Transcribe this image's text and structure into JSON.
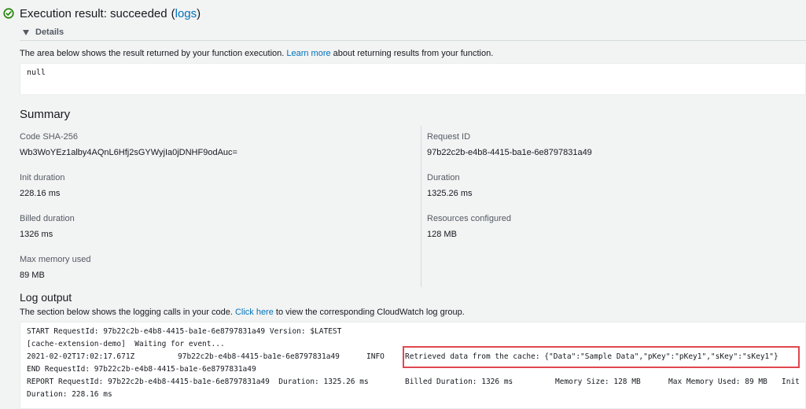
{
  "execution": {
    "status_prefix": "Execution result: succeeded",
    "open_paren": "(",
    "logs_link": "logs",
    "close_paren": ")"
  },
  "details": {
    "toggle_label": "Details",
    "desc_before": "The area below shows the result returned by your function execution. ",
    "desc_link": "Learn more",
    "desc_after": " about returning results from your function.",
    "result_value": "null"
  },
  "summary": {
    "heading": "Summary",
    "fields": [
      {
        "label": "Code SHA-256",
        "value": "Wb3WoYEz1alby4AQnL6Hfj2sGYWyjIa0jDNHF9odAuc="
      },
      {
        "label": "Request ID",
        "value": "97b22c2b-e4b8-4415-ba1e-6e8797831a49"
      },
      {
        "label": "Init duration",
        "value": "228.16 ms"
      },
      {
        "label": "Duration",
        "value": "1325.26 ms"
      },
      {
        "label": "Billed duration",
        "value": "1326 ms"
      },
      {
        "label": "Resources configured",
        "value": "128 MB"
      },
      {
        "label": "Max memory used",
        "value": "89 MB"
      }
    ]
  },
  "log_output": {
    "heading": "Log output",
    "desc_before": "The section below shows the logging calls in your code. ",
    "desc_link": "Click here",
    "desc_after": " to view the corresponding CloudWatch log group.",
    "line1": "START RequestId: 97b22c2b-e4b8-4415-ba1e-6e8797831a49 Version: $LATEST",
    "line2": "[cache-extension-demo]  Waiting for event...",
    "line3_timestamp": "2021-02-02T17:02:17.671Z",
    "line3_request": "97b22c2b-e4b8-4415-ba1e-6e8797831a49",
    "line3_level": "INFO",
    "line3_message": "Retrieved data from the cache: {\"Data\":\"Sample Data\",\"pKey\":\"pKey1\",\"sKey\":\"sKey1\"}",
    "line4": "END RequestId: 97b22c2b-e4b8-4415-ba1e-6e8797831a49",
    "line5_request": "REPORT RequestId: 97b22c2b-e4b8-4415-ba1e-6e8797831a49  Duration: 1325.26 ms",
    "line5_billed": "Billed Duration: 1326 ms",
    "line5_memory": "Memory Size: 128 MB",
    "line5_maxmem": "Max Memory Used: 89 MB",
    "line5_init": "Init",
    "line6": "Duration: 228.16 ms"
  },
  "colors": {
    "success": "#1d8102",
    "link": "#0073bb",
    "highlight": "#e0474f"
  },
  "icons": {
    "status": "check-circle-icon",
    "toggle": "caret-down-icon"
  }
}
